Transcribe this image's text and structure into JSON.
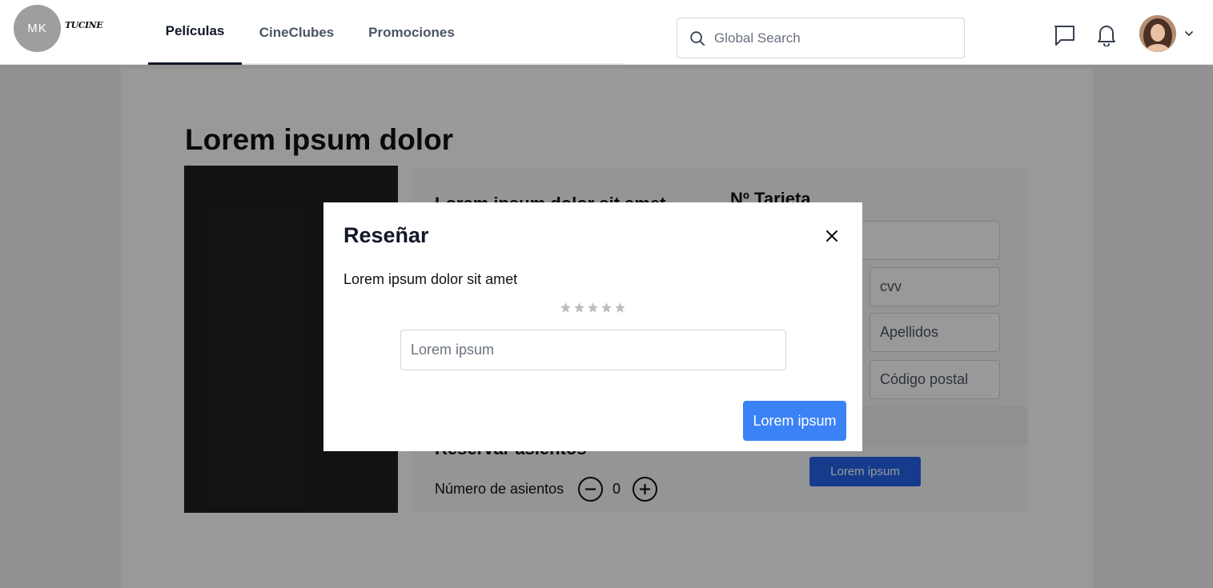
{
  "header": {
    "logo_initials": "MK",
    "logo_text": "TUCINE",
    "tabs": [
      {
        "label": "Películas",
        "active": true
      },
      {
        "label": "CineClubes",
        "active": false
      },
      {
        "label": "Promociones",
        "active": false
      }
    ],
    "search_placeholder": "Global Search",
    "icons": [
      "chat-icon",
      "bell-icon",
      "chevron-down-icon"
    ]
  },
  "page": {
    "title": "Lorem ipsum dolor",
    "panel": {
      "left_heading": "Lorem ipsum dolor sit amet",
      "card_heading": "Nº Tarjeta",
      "fields": [
        "cvv",
        "Apellidos",
        "Código postal"
      ],
      "pay_button": "Lorem ipsum",
      "seats_heading": "Reservar asientos",
      "seats_label": "Número de asientos",
      "seats_count": "0"
    }
  },
  "modal": {
    "title": "Reseñar",
    "text": "Lorem ipsum dolor sit amet",
    "rating": {
      "value": 0,
      "max": 5
    },
    "input_placeholder": "Lorem ipsum",
    "submit_label": "Lorem ipsum"
  }
}
